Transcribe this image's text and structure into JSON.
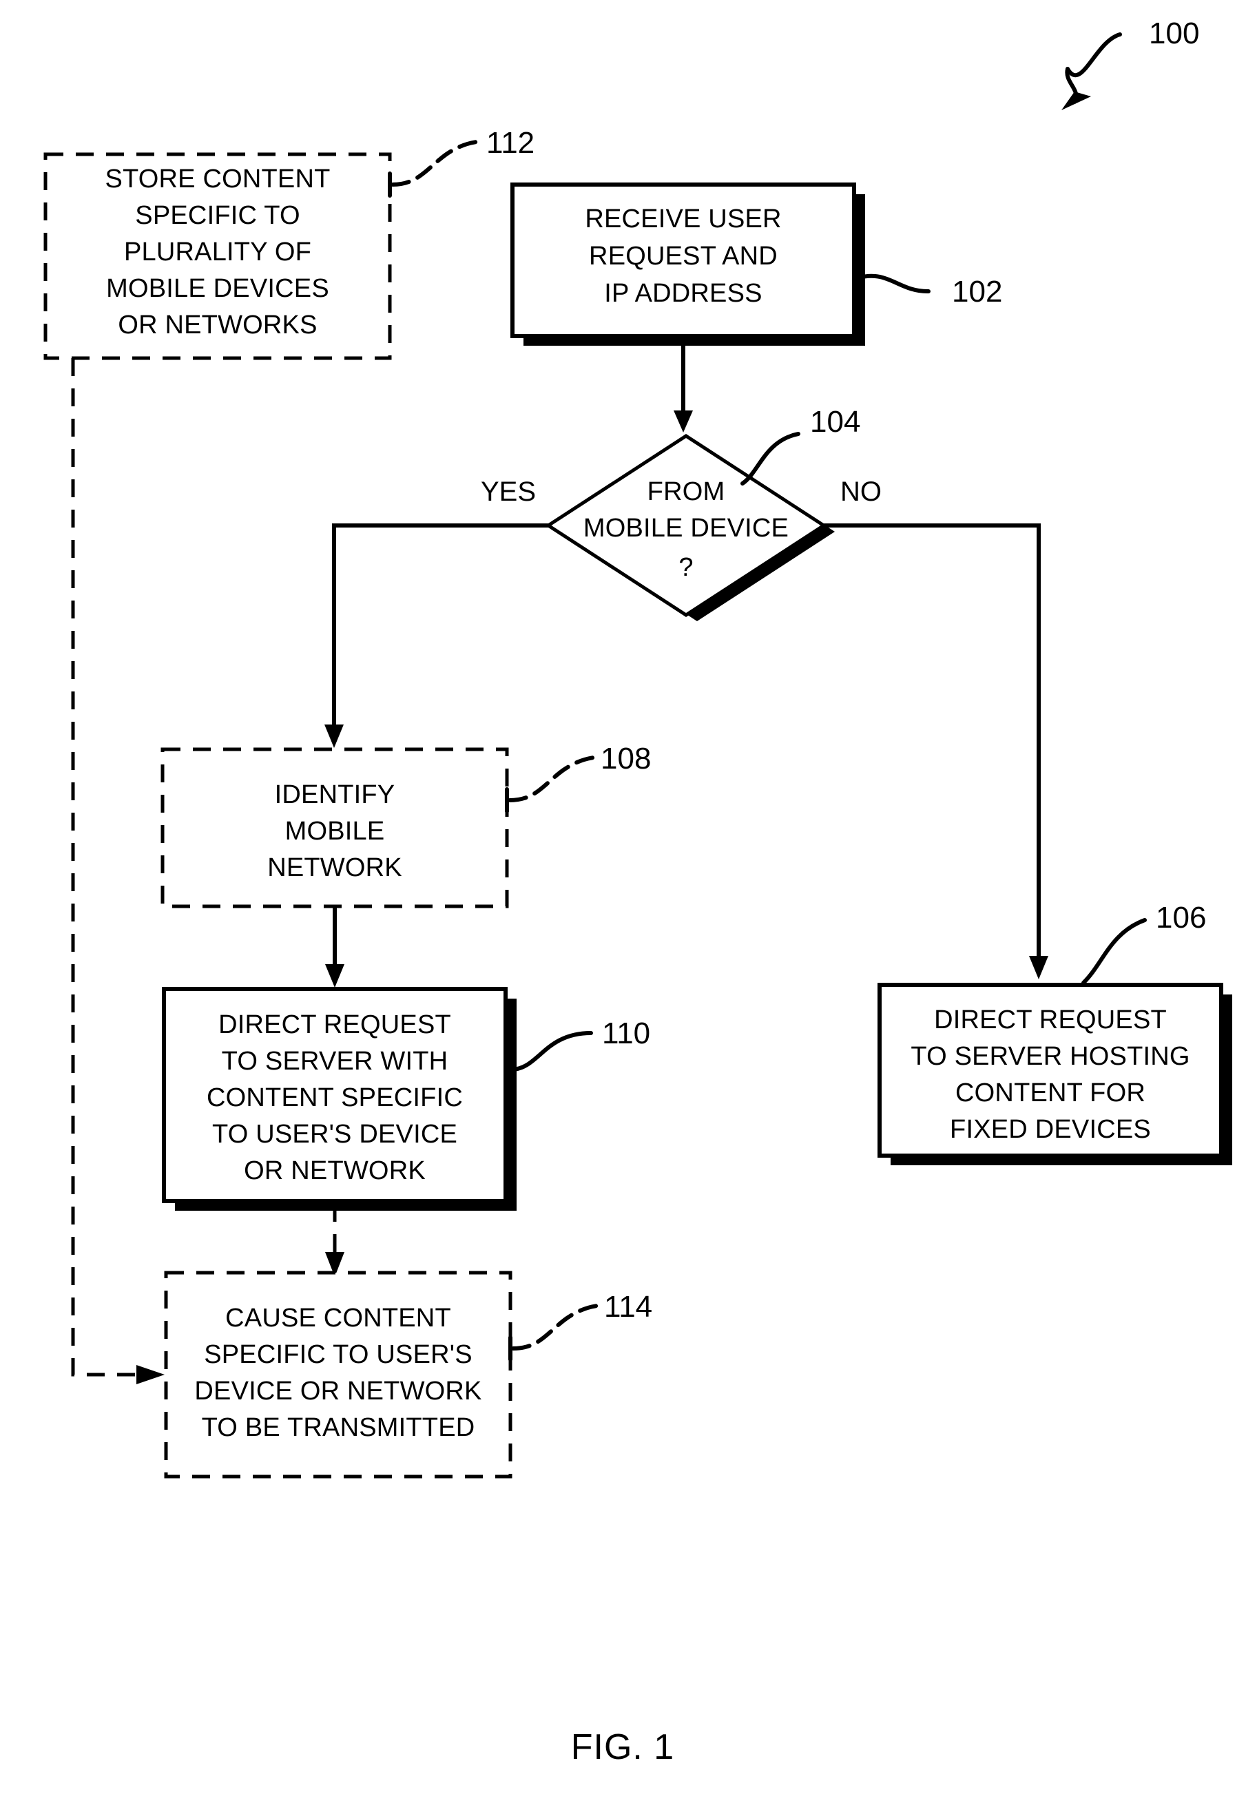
{
  "figure": {
    "caption": "FIG. 1",
    "diagram_ref": "100"
  },
  "nodes": {
    "store_content": {
      "ref": "112",
      "style": "dashed",
      "lines": [
        "STORE CONTENT",
        "SPECIFIC TO",
        "PLURALITY OF",
        "MOBILE DEVICES",
        "OR NETWORKS"
      ]
    },
    "receive_request": {
      "ref": "102",
      "style": "solid-shadow",
      "lines": [
        "RECEIVE USER",
        "REQUEST AND",
        "IP ADDRESS"
      ]
    },
    "decision": {
      "ref": "104",
      "style": "diamond-shadow",
      "lines": [
        "FROM",
        "MOBILE DEVICE",
        "?"
      ],
      "branch_yes": "YES",
      "branch_no": "NO"
    },
    "identify_network": {
      "ref": "108",
      "style": "dashed",
      "lines": [
        "IDENTIFY",
        "MOBILE",
        "NETWORK"
      ]
    },
    "direct_specific": {
      "ref": "110",
      "style": "solid-shadow",
      "lines": [
        "DIRECT REQUEST",
        "TO SERVER WITH",
        "CONTENT SPECIFIC",
        "TO USER'S DEVICE",
        "OR NETWORK"
      ]
    },
    "direct_fixed": {
      "ref": "106",
      "style": "solid-shadow",
      "lines": [
        "DIRECT REQUEST",
        "TO SERVER HOSTING",
        "CONTENT FOR",
        "FIXED DEVICES"
      ]
    },
    "cause_content": {
      "ref": "114",
      "style": "dashed",
      "lines": [
        "CAUSE CONTENT",
        "SPECIFIC TO USER'S",
        "DEVICE OR NETWORK",
        "TO BE TRANSMITTED"
      ]
    }
  },
  "colors": {
    "ink": "#000000",
    "paper": "#ffffff"
  }
}
